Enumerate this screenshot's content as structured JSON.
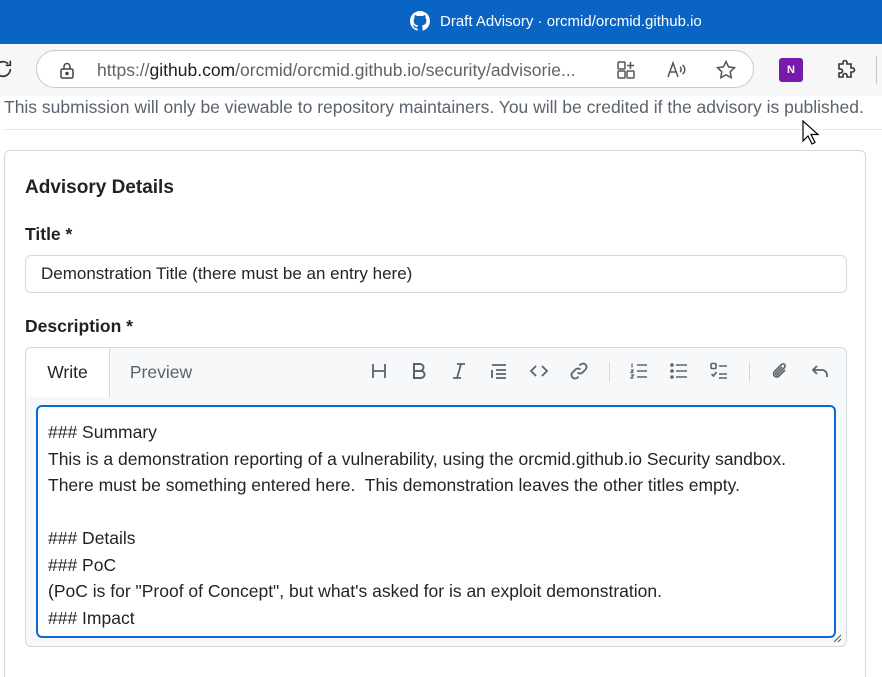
{
  "window": {
    "title": "Draft Advisory · orcmid/orcmid.github.io"
  },
  "browser": {
    "url_prefix": "https://",
    "url_domain": "github.com",
    "url_path": "/orcmid/orcmid.github.io/security/advisorie..."
  },
  "page": {
    "notice": "This submission will only be viewable to repository maintainers. You will be credited if the advisory is published."
  },
  "advisory": {
    "heading": "Advisory Details",
    "title_label": "Title *",
    "title_value": "Demonstration Title (there must be an entry here)",
    "description_label": "Description *",
    "tabs": {
      "write": "Write",
      "preview": "Preview"
    },
    "description_value": "### Summary\nThis is a demonstration reporting of a vulnerability, using the orcmid.github.io Security sandbox.\nThere must be something entered here.  This demonstration leaves the other titles empty.\n\n### Details\n### PoC\n(PoC is for \"Proof of Concept\", but what's asked for is an exploit demonstration.\n### Impact"
  },
  "colors": {
    "titlebar": "#0a64c4",
    "focus_border": "#0969da",
    "onenote": "#7719aa"
  },
  "icons": {
    "toolbar": [
      "heading-icon",
      "bold-icon",
      "italic-icon",
      "quote-icon",
      "code-icon",
      "link-icon",
      "ordered-list-icon",
      "unordered-list-icon",
      "task-list-icon",
      "attach-icon",
      "undo-icon"
    ]
  }
}
